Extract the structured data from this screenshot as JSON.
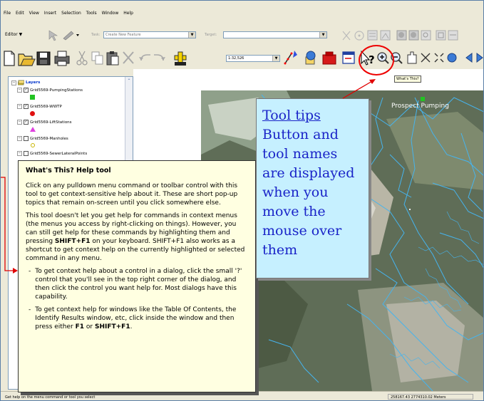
{
  "menu": [
    "File",
    "Edit",
    "View",
    "Insert",
    "Selection",
    "Tools",
    "Window",
    "Help"
  ],
  "editor": {
    "label": "Editor ▼",
    "task_label": "Task:",
    "task_value": "Create New Feature",
    "target_label": "Target:",
    "target_value": ""
  },
  "toolbar": {
    "scale": "1:32,526"
  },
  "toc": {
    "root": "Layers",
    "layers": [
      {
        "name": "Grid5569-PumpingStations",
        "checked": true,
        "symbol": "square",
        "color": "#22c322"
      },
      {
        "name": "Grid5569-WWTP",
        "checked": true,
        "symbol": "circle",
        "color": "#e01010"
      },
      {
        "name": "Grid5569-LiftStations",
        "checked": true,
        "symbol": "triangle",
        "color": "#e040e0"
      },
      {
        "name": "Grid5569-Manholes",
        "checked": false,
        "symbol": "dot",
        "color": "#c8b400"
      },
      {
        "name": "Grid5569-SewerLateralPoints",
        "checked": false,
        "symbol": "none",
        "color": "#000000"
      }
    ]
  },
  "map": {
    "label": "Prospect Pumping"
  },
  "tooltip": {
    "text": "What's This?"
  },
  "help": {
    "title": "What's This? Help tool",
    "para1": "Click on any pulldown menu command or toolbar control with this tool to get context-sensitive help about it. These are short pop-up topics that remain on-screen until you click somewhere else.",
    "para2_a": "This tool doesn't let you get help for commands in context menus (the menus you access by right-clicking on things). However, you can still get help for these commands by highlighting them and pressing ",
    "para2_b1": "SHIFT+F1",
    "para2_c": " on your keyboard. SHIFT+F1 also works as a shortcut to get context help on the currently highlighted or selected command in any menu.",
    "bullet1": "To get context help about a control in a dialog, click the small '?' control that you'll see in the top right corner of the dialog, and then click the control you want help for. Most dialogs have this capability.",
    "bullet2_a": "To get context help for windows like the Table Of Contents, the Identify Results window, etc, click inside the window and then press either ",
    "bullet2_b": "F1",
    "bullet2_c": " or ",
    "bullet2_d": "SHIFT+F1",
    "bullet2_e": "."
  },
  "callout": {
    "heading": "Tool tips",
    "body": [
      "Button and",
      "tool names",
      "are displayed",
      "when you",
      "move the",
      "mouse over",
      "them"
    ]
  },
  "status": {
    "left": "Get help on the menu command or tool you select",
    "coords": "258167.43  2774310.02 Meters"
  },
  "colors": {
    "callout_bg": "#c6f0ff",
    "callout_text": "#1a24c8",
    "help_bg": "#ffffe1",
    "annotation_red": "#e00000"
  }
}
